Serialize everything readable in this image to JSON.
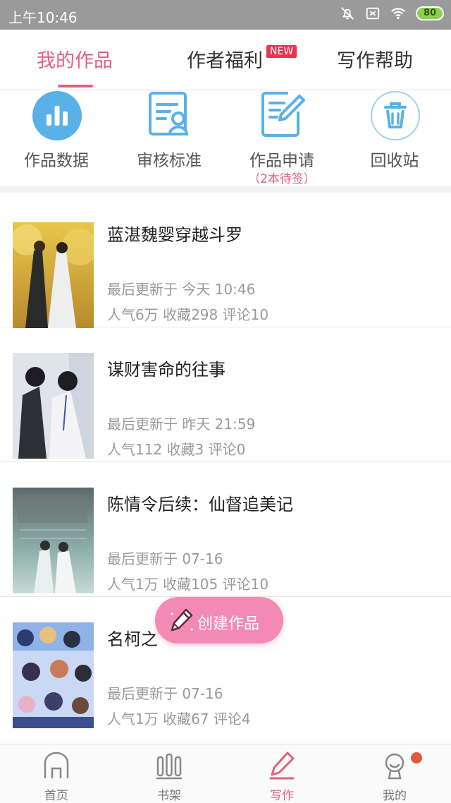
{
  "status_bar": {
    "time": "上午10:46",
    "battery": "80",
    "icons": [
      "mute-bell-icon",
      "sim-off-icon",
      "wifi-icon",
      "battery-icon"
    ]
  },
  "top_tabs": [
    {
      "label": "我的作品",
      "active": true
    },
    {
      "label": "作者福利",
      "badge": "NEW"
    },
    {
      "label": "写作帮助"
    }
  ],
  "quick_actions": [
    {
      "label": "作品数据",
      "icon": "bar-chart-icon"
    },
    {
      "label": "审核标准",
      "icon": "review-form-icon"
    },
    {
      "label": "作品申请",
      "sub": "（2本待签）",
      "icon": "edit-document-icon"
    },
    {
      "label": "回收站",
      "icon": "trash-icon"
    }
  ],
  "works": [
    {
      "title": "蓝湛魏婴穿越斗罗",
      "updated": "最后更新于 今天 10:46",
      "stats": "人气6万 收藏298 评论10"
    },
    {
      "title": "谋财害命的往事",
      "updated": "最后更新于 昨天 21:59",
      "stats": "人气112 收藏3 评论0"
    },
    {
      "title": "陈情令后续：仙督追美记",
      "updated": "最后更新于 07-16",
      "stats": "人气1万 收藏105 评论10"
    },
    {
      "title": "名柯之",
      "updated": "最后更新于 07-16",
      "stats": "人气1万 收藏67 评论4"
    }
  ],
  "create_button": {
    "label": "创建作品",
    "icon": "pencil-icon"
  },
  "bottom_nav": [
    {
      "label": "首页",
      "icon": "home-icon"
    },
    {
      "label": "书架",
      "icon": "bookshelf-icon"
    },
    {
      "label": "写作",
      "icon": "write-icon",
      "active": true
    },
    {
      "label": "我的",
      "icon": "profile-icon"
    }
  ],
  "colors": {
    "accent": "#e35f7f",
    "icon_blue": "#5ab0e8",
    "create_pink": "#f38ab3",
    "status_gray": "#9a9a9a"
  }
}
